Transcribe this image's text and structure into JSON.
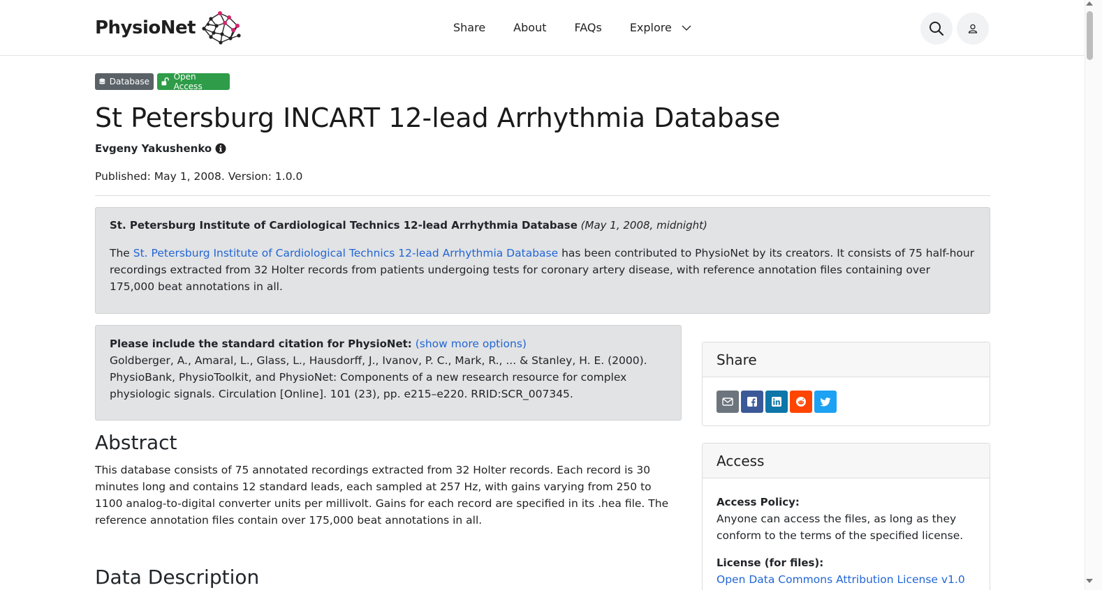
{
  "header": {
    "brand": "PhysioNet",
    "nav": [
      "Share",
      "About",
      "FAQs",
      "Explore"
    ]
  },
  "badges": {
    "database": "Database",
    "open_access": "Open Access"
  },
  "project": {
    "title": "St Petersburg INCART 12-lead Arrhythmia Database",
    "author": "Evgeny Yakushenko",
    "published": "Published: May 1, 2008. Version: 1.0.0"
  },
  "announcement": {
    "heading": "St. Petersburg Institute of Cardiological Technics 12-lead Arrhythmia Database",
    "date": "(May 1, 2008, midnight)",
    "body_prefix": "The ",
    "body_link": "St. Petersburg Institute of Cardiological Technics 12-lead Arrhythmia Database",
    "body_suffix": " has been contributed to PhysioNet by its creators. It consists of 75 half-hour recordings extracted from 32 Holter records from patients undergoing tests for coronary artery disease, with reference annotation files containing over 175,000 beat annotations in all."
  },
  "citation": {
    "heading": "Please include the standard citation for PhysioNet:",
    "more_link": "(show more options)",
    "text": "Goldberger, A., Amaral, L., Glass, L., Hausdorff, J., Ivanov, P. C., Mark, R., ... & Stanley, H. E. (2000). PhysioBank, PhysioToolkit, and PhysioNet: Components of a new research resource for complex physiologic signals. Circulation [Online]. 101 (23), pp. e215–e220. RRID:SCR_007345."
  },
  "abstract": {
    "heading": "Abstract",
    "text": "This database consists of 75 annotated recordings extracted from 32 Holter records. Each record is 30 minutes long and contains 12 standard leads, each sampled at 257 Hz, with gains varying from 250 to 1100 analog-to-digital converter units per millivolt. Gains for each record are specified in its .hea file. The reference annotation files contain over 175,000 beat annotations in all."
  },
  "data_description": {
    "heading": "Data Description"
  },
  "share_card": {
    "title": "Share",
    "buttons": [
      {
        "icon": "email-icon",
        "color": "#6c757d"
      },
      {
        "icon": "facebook-icon",
        "color": "#3b5998"
      },
      {
        "icon": "linkedin-icon",
        "color": "#0e76a8"
      },
      {
        "icon": "reddit-icon",
        "color": "#ff4500"
      },
      {
        "icon": "twitter-icon",
        "color": "#1da1f2"
      }
    ]
  },
  "access_card": {
    "title": "Access",
    "policy_label": "Access Policy:",
    "policy_text": "Anyone can access the files, as long as they conform to the terms of the specified license.",
    "license_label": "License (for files):",
    "license_link": "Open Data Commons Attribution License v1.0"
  },
  "colors": {
    "link": "#2266d4",
    "badge_database": "#5a6268",
    "badge_open_access": "#2e9c48",
    "alert_bg": "#e2e3e5",
    "brand_accent": "#d6246e"
  }
}
